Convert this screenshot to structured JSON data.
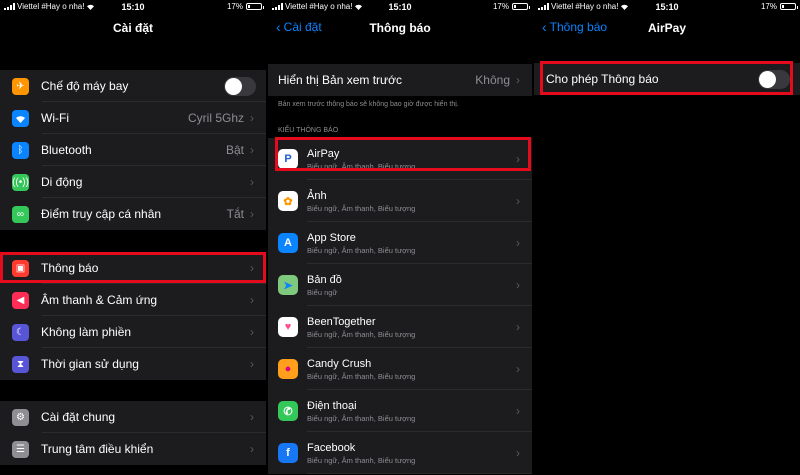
{
  "status_bar": {
    "carrier": "Viettel #Hay o nha!",
    "time": "15:10",
    "battery": "17%",
    "battery_level": 0.17
  },
  "panel1": {
    "title": "Cài đặt",
    "group1": [
      {
        "icon": "airplane-icon",
        "label": "Chế độ máy bay",
        "type": "toggle",
        "on": false,
        "color": "#ff9500"
      },
      {
        "icon": "wifi-icon",
        "label": "Wi-Fi",
        "value": "Cyril 5Ghz",
        "color": "#0a84ff"
      },
      {
        "icon": "bluetooth-icon",
        "label": "Bluetooth",
        "value": "Bật",
        "color": "#0a84ff"
      },
      {
        "icon": "cellular-icon",
        "label": "Di động",
        "value": "",
        "color": "#34c759"
      },
      {
        "icon": "hotspot-icon",
        "label": "Điểm truy cập cá nhân",
        "value": "Tắt",
        "color": "#34c759"
      }
    ],
    "group2": [
      {
        "icon": "notifications-icon",
        "label": "Thông báo",
        "color": "#ff3b30"
      },
      {
        "icon": "sound-icon",
        "label": "Âm thanh & Cảm ứng",
        "color": "#ff2d55"
      },
      {
        "icon": "do-not-disturb-icon",
        "label": "Không làm phiền",
        "color": "#5856d6"
      },
      {
        "icon": "screen-time-icon",
        "label": "Thời gian sử dụng",
        "color": "#5856d6"
      }
    ],
    "group3": [
      {
        "icon": "general-icon",
        "label": "Cài đặt chung",
        "color": "#8e8e93"
      },
      {
        "icon": "control-center-icon",
        "label": "Trung tâm điều khiển",
        "color": "#8e8e93"
      }
    ]
  },
  "panel2": {
    "back": "Cài đặt",
    "title": "Thông báo",
    "preview_label": "Hiển thị Bản xem trước",
    "preview_value": "Không",
    "preview_caption": "Bản xem trước thông báo sẽ không bao giờ được hiển thị.",
    "section_header": "KIỂU THÔNG BÁO",
    "apps": [
      {
        "icon": "airpay-icon",
        "glyph": "P",
        "name": "AirPay",
        "sub": "Biểu ngữ, Âm thanh, Biểu tượng",
        "color": "#ffffff",
        "fg": "#1e5cd6"
      },
      {
        "icon": "photos-icon",
        "glyph": "✿",
        "name": "Ảnh",
        "sub": "Biểu ngữ, Âm thanh, Biểu tượng",
        "color": "#ffffff",
        "fg": "#ff9500"
      },
      {
        "icon": "app-store-icon",
        "glyph": "A",
        "name": "App Store",
        "sub": "Biểu ngữ, Âm thanh, Biểu tượng",
        "color": "#0a84ff",
        "fg": "#ffffff"
      },
      {
        "icon": "maps-icon",
        "glyph": "➤",
        "name": "Bản đồ",
        "sub": "Biểu ngữ",
        "color": "#7fc97f",
        "fg": "#0a84ff"
      },
      {
        "icon": "beentogether-icon",
        "glyph": "♥",
        "name": "BeenTogether",
        "sub": "Biểu ngữ, Âm thanh, Biểu tượng",
        "color": "#ffffff",
        "fg": "#ff4f8b"
      },
      {
        "icon": "candy-crush-icon",
        "glyph": "●",
        "name": "Candy Crush",
        "sub": "Biểu ngữ, Âm thanh, Biểu tượng",
        "color": "#ff9f1c",
        "fg": "#e4007c"
      },
      {
        "icon": "phone-icon",
        "glyph": "✆",
        "name": "Điện thoại",
        "sub": "Biểu ngữ, Âm thanh, Biểu tượng",
        "color": "#34c759",
        "fg": "#ffffff"
      },
      {
        "icon": "facebook-icon",
        "glyph": "f",
        "name": "Facebook",
        "sub": "Biểu ngữ, Âm thanh, Biểu tượng",
        "color": "#1877f2",
        "fg": "#ffffff"
      }
    ]
  },
  "panel3": {
    "back": "Thông báo",
    "title": "AirPay",
    "allow_label": "Cho phép Thông báo",
    "allow_on": false
  },
  "colors": {
    "highlight": "#e30b1c",
    "accent": "#0a84ff"
  }
}
